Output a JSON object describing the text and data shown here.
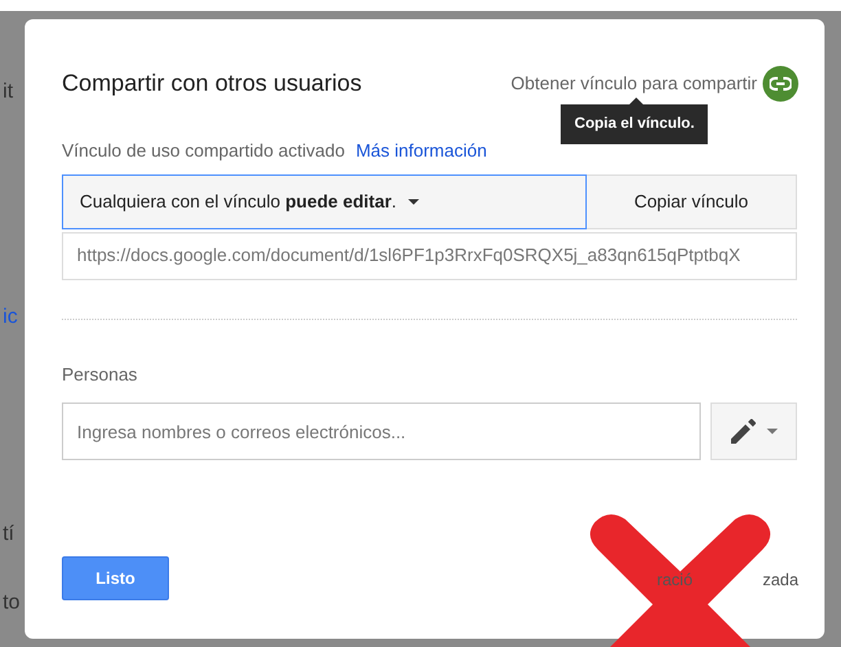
{
  "background_fragments": [
    "it",
    "ic",
    "tí",
    "to"
  ],
  "dialog": {
    "title": "Compartir con otros usuarios",
    "get_link": "Obtener vínculo para compartir",
    "tooltip": "Copia el vínculo.",
    "link_status": "Vínculo de uso compartido activado",
    "more_info": "Más información",
    "access_dropdown": "Cualquiera con el vínculo **puede editar**.",
    "copy_button": "Copiar vínculo",
    "url": "https://docs.google.com/document/d/1sl6PF1p3RrxFq0SRQX5j_a83qn615qPtptbqX",
    "people_label": "Personas",
    "people_field": {
      "placeholder": "Ingresa nombres o correos electrónicos..."
    },
    "done_button": "Listo",
    "advanced_fragments": [
      "ració",
      "zada"
    ]
  }
}
